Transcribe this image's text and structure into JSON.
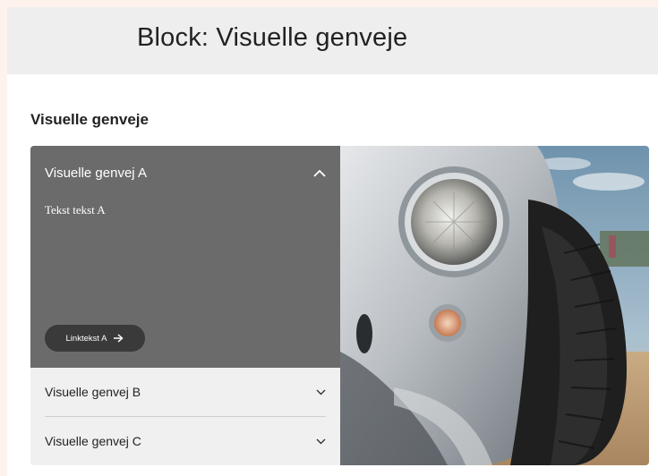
{
  "header": {
    "title": "Block: Visuelle genveje"
  },
  "section": {
    "title": "Visuelle genveje"
  },
  "accordion": {
    "items": [
      {
        "label": "Visuelle genvej A",
        "expanded": true,
        "body": "Tekst tekst A",
        "link_label": "Linktekst A"
      },
      {
        "label": "Visuelle genvej B",
        "expanded": false
      },
      {
        "label": "Visuelle genvej C",
        "expanded": false
      }
    ]
  },
  "image": {
    "subject": "vintage silver car headlight and tire"
  },
  "colors": {
    "header_band": "#eeeeee",
    "open_panel": "#6b6b6b",
    "closed_panel": "#f0f0f0",
    "link_button": "#3a3a3a"
  },
  "icons": {
    "expanded": "chevron-up-icon",
    "collapsed": "chevron-down-icon",
    "link": "arrow-right-icon"
  }
}
